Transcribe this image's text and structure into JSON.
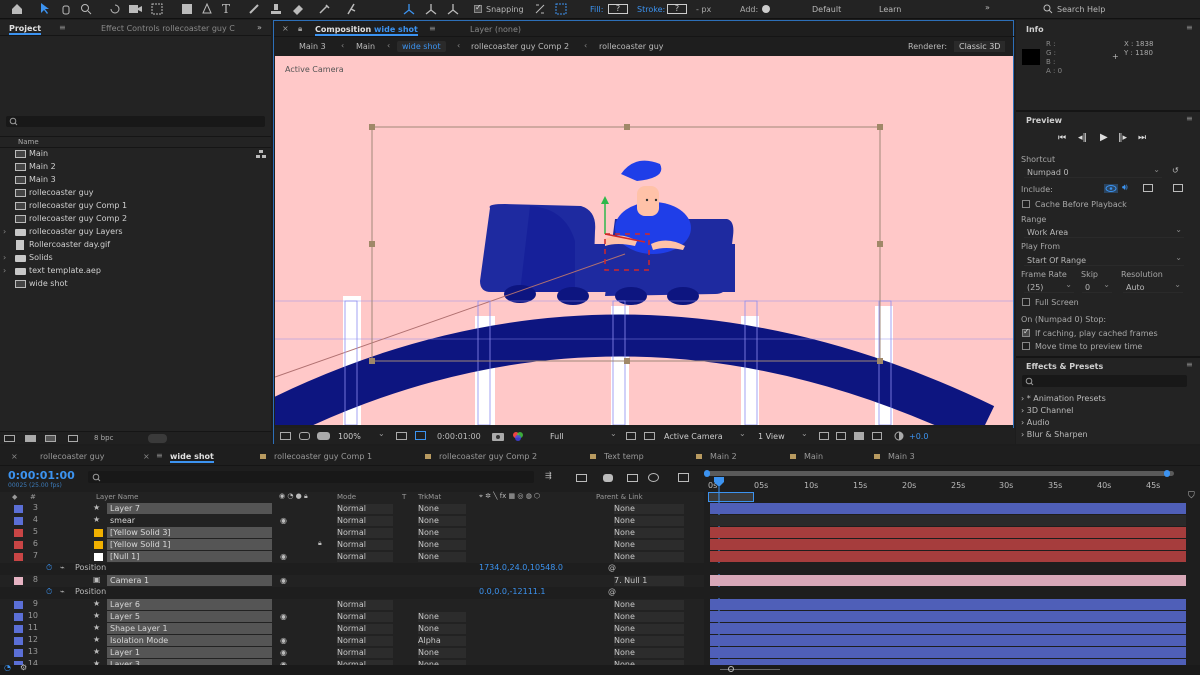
{
  "toolbar": {
    "snapping": "Snapping",
    "fill_label": "Fill:",
    "stroke_label": "Stroke:",
    "stroke_units": "- px",
    "add_label": "Add:",
    "workspaces": [
      "Default",
      "Learn"
    ],
    "search_help": "Search Help"
  },
  "project": {
    "tab": "Project",
    "effect_tab": "Effect Controls rollecoaster guy C",
    "column": "Name",
    "items": [
      {
        "name": "Main",
        "icon": "comp-icon"
      },
      {
        "name": "Main 2",
        "icon": "comp-icon"
      },
      {
        "name": "Main 3",
        "icon": "comp-icon"
      },
      {
        "name": "rollecoaster guy",
        "icon": "comp-icon"
      },
      {
        "name": "rollecoaster guy Comp 1",
        "icon": "comp-icon"
      },
      {
        "name": "rollecoaster guy Comp 2",
        "icon": "comp-icon"
      },
      {
        "name": "rollecoaster guy Layers",
        "icon": "folder-icon"
      },
      {
        "name": "Rollercoaster day.gif",
        "icon": "file-icon"
      },
      {
        "name": "Solids",
        "icon": "folder-icon"
      },
      {
        "name": "text template.aep",
        "icon": "folder-icon"
      },
      {
        "name": "wide shot",
        "icon": "comp-icon"
      }
    ],
    "bpc": "8 bpc"
  },
  "composition": {
    "tab_prefix": "Composition",
    "tab_name": "wide shot",
    "layer_tab": "Layer (none)",
    "breadcrumbs": [
      "Main 3",
      "Main",
      "wide shot",
      "rollecoaster guy Comp 2",
      "rollecoaster guy"
    ],
    "renderer_label": "Renderer:",
    "renderer": "Classic 3D",
    "view_label": "Active Camera",
    "zoom": "100%",
    "timecode": "0:00:01:00",
    "resolution": "Full",
    "camera": "Active Camera",
    "views": "1 View",
    "exposure": "+0.0"
  },
  "info": {
    "title": "Info",
    "r": "R :",
    "g": "G :",
    "b": "B :",
    "a": "A : 0",
    "x": "X : 1838",
    "y": "Y : 1180"
  },
  "preview": {
    "title": "Preview",
    "shortcut_label": "Shortcut",
    "shortcut": "Numpad 0",
    "include_label": "Include:",
    "cache": "Cache Before Playback",
    "range_label": "Range",
    "range": "Work Area",
    "play_from_label": "Play From",
    "play_from": "Start Of Range",
    "frame_rate_label": "Frame Rate",
    "skip_label": "Skip",
    "resolution_label": "Resolution",
    "frame_rate": "(25)",
    "skip": "0",
    "resolution": "Auto",
    "full_screen": "Full Screen",
    "stop_label": "On (Numpad 0) Stop:",
    "if_caching": "If caching, play cached frames",
    "move_time": "Move time to preview time"
  },
  "effects": {
    "title": "Effects & Presets",
    "items": [
      "* Animation Presets",
      "3D Channel",
      "Audio",
      "Blur & Sharpen"
    ]
  },
  "timeline": {
    "tabs": [
      "rollecoaster guy",
      "wide shot",
      "rollecoaster guy Comp 1",
      "rollecoaster guy Comp 2",
      "Text temp",
      "Main 2",
      "Main",
      "Main 3"
    ],
    "timecode": "0:00:01:00",
    "frames": "00025 (25.00 fps)",
    "col_layer": "Layer Name",
    "col_mode": "Mode",
    "col_t": "T",
    "col_trkmat": "TrkMat",
    "col_parent": "Parent & Link",
    "ruler": [
      "0s",
      "05s",
      "10s",
      "15s",
      "20s",
      "25s",
      "30s",
      "35s",
      "40s",
      "45s"
    ],
    "layers": [
      {
        "num": "3",
        "name": "Layer 7",
        "mode": "Normal",
        "trk": "None",
        "parent": "None",
        "color": "#5b6fd6",
        "chip": "star",
        "bar": "#4f5fb8"
      },
      {
        "num": "4",
        "name": "smear",
        "mode": "Normal",
        "trk": "None",
        "parent": "None",
        "color": "#5b6fd6",
        "chip": "star",
        "bar": "#3a3a3a"
      },
      {
        "num": "5",
        "name": "[Yellow Solid 3]",
        "mode": "Normal",
        "trk": "None",
        "parent": "None",
        "color": "#c94545",
        "chip": "yellow",
        "bar": "#a63d3d"
      },
      {
        "num": "6",
        "name": "[Yellow Solid 1]",
        "mode": "Normal",
        "trk": "None",
        "parent": "None",
        "color": "#c94545",
        "chip": "yellow",
        "bar": "#a63d3d"
      },
      {
        "num": "7",
        "name": "[Null 1]",
        "mode": "Normal",
        "trk": "None",
        "parent": "None",
        "color": "#c94545",
        "chip": "white",
        "bar": "#a63d3d"
      },
      {
        "num": "8",
        "name": "Camera 1",
        "mode": "",
        "trk": "",
        "parent": "7. Null 1",
        "color": "#e6b3c3",
        "chip": "camera",
        "bar": "#d8a8b8"
      },
      {
        "num": "9",
        "name": "Layer 6",
        "mode": "Normal",
        "trk": "",
        "parent": "None",
        "color": "#5b6fd6",
        "chip": "star",
        "bar": "#4f5fb8"
      },
      {
        "num": "10",
        "name": "Layer 5",
        "mode": "Normal",
        "trk": "None",
        "parent": "None",
        "color": "#5b6fd6",
        "chip": "star",
        "bar": "#4f5fb8"
      },
      {
        "num": "11",
        "name": "Shape Layer 1",
        "mode": "Normal",
        "trk": "None",
        "parent": "None",
        "color": "#5b6fd6",
        "chip": "star",
        "bar": "#4f5fb8"
      },
      {
        "num": "12",
        "name": "Isolation Mode",
        "mode": "Normal",
        "trk": "Alpha",
        "parent": "None",
        "color": "#5b6fd6",
        "chip": "star",
        "bar": "#4f5fb8"
      },
      {
        "num": "13",
        "name": "Layer 1",
        "mode": "Normal",
        "trk": "None",
        "parent": "None",
        "color": "#5b6fd6",
        "chip": "star",
        "bar": "#4f5fb8"
      },
      {
        "num": "14",
        "name": "Layer 3",
        "mode": "Normal",
        "trk": "None",
        "parent": "None",
        "color": "#5b6fd6",
        "chip": "star",
        "bar": "#4f5fb8"
      }
    ],
    "position_label": "Position",
    "null_position": "1734.0,24.0,10548.0",
    "cam_position": "0.0,0.0,-12111.1"
  },
  "colors": {
    "accent": "#2d8ceb",
    "canvas": "#ffc8c8",
    "coaster": "#0d1580",
    "cart": "#1e2aa0",
    "shirt": "#1f3ee8"
  }
}
